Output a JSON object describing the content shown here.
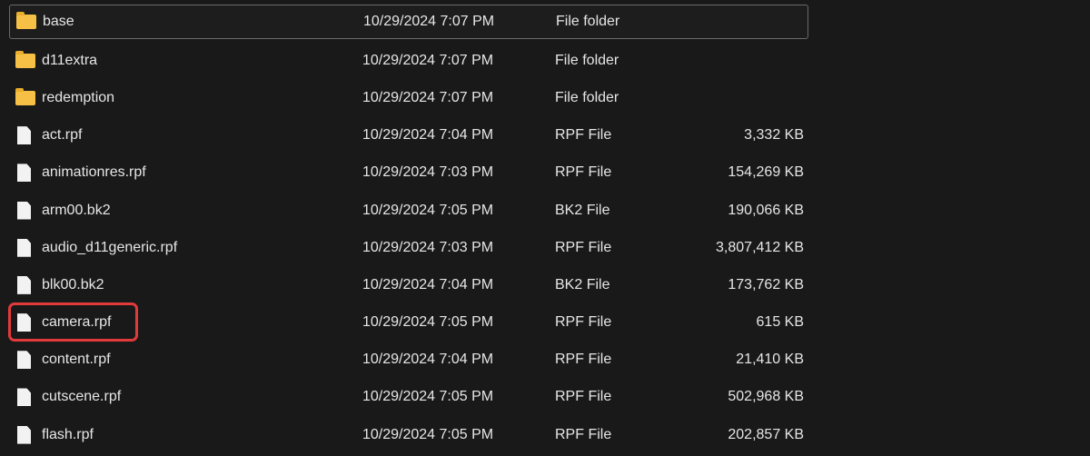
{
  "files": [
    {
      "name": "base",
      "date": "10/29/2024 7:07 PM",
      "type": "File folder",
      "size": "",
      "icon": "folder-icon"
    },
    {
      "name": "d11extra",
      "date": "10/29/2024 7:07 PM",
      "type": "File folder",
      "size": "",
      "icon": "folder-icon"
    },
    {
      "name": "redemption",
      "date": "10/29/2024 7:07 PM",
      "type": "File folder",
      "size": "",
      "icon": "folder-icon"
    },
    {
      "name": "act.rpf",
      "date": "10/29/2024 7:04 PM",
      "type": "RPF File",
      "size": "3,332 KB",
      "icon": "file-icon"
    },
    {
      "name": "animationres.rpf",
      "date": "10/29/2024 7:03 PM",
      "type": "RPF File",
      "size": "154,269 KB",
      "icon": "file-icon"
    },
    {
      "name": "arm00.bk2",
      "date": "10/29/2024 7:05 PM",
      "type": "BK2 File",
      "size": "190,066 KB",
      "icon": "file-icon"
    },
    {
      "name": "audio_d11generic.rpf",
      "date": "10/29/2024 7:03 PM",
      "type": "RPF File",
      "size": "3,807,412 KB",
      "icon": "file-icon"
    },
    {
      "name": "blk00.bk2",
      "date": "10/29/2024 7:04 PM",
      "type": "BK2 File",
      "size": "173,762 KB",
      "icon": "file-icon"
    },
    {
      "name": "camera.rpf",
      "date": "10/29/2024 7:05 PM",
      "type": "RPF File",
      "size": "615 KB",
      "icon": "file-icon"
    },
    {
      "name": "content.rpf",
      "date": "10/29/2024 7:04 PM",
      "type": "RPF File",
      "size": "21,410 KB",
      "icon": "file-icon"
    },
    {
      "name": "cutscene.rpf",
      "date": "10/29/2024 7:05 PM",
      "type": "RPF File",
      "size": "502,968 KB",
      "icon": "file-icon"
    },
    {
      "name": "flash.rpf",
      "date": "10/29/2024 7:05 PM",
      "type": "RPF File",
      "size": "202,857 KB",
      "icon": "file-icon"
    }
  ],
  "colors": {
    "highlight": "#e23a3a",
    "folder": "#f5c045",
    "background": "#191919"
  }
}
